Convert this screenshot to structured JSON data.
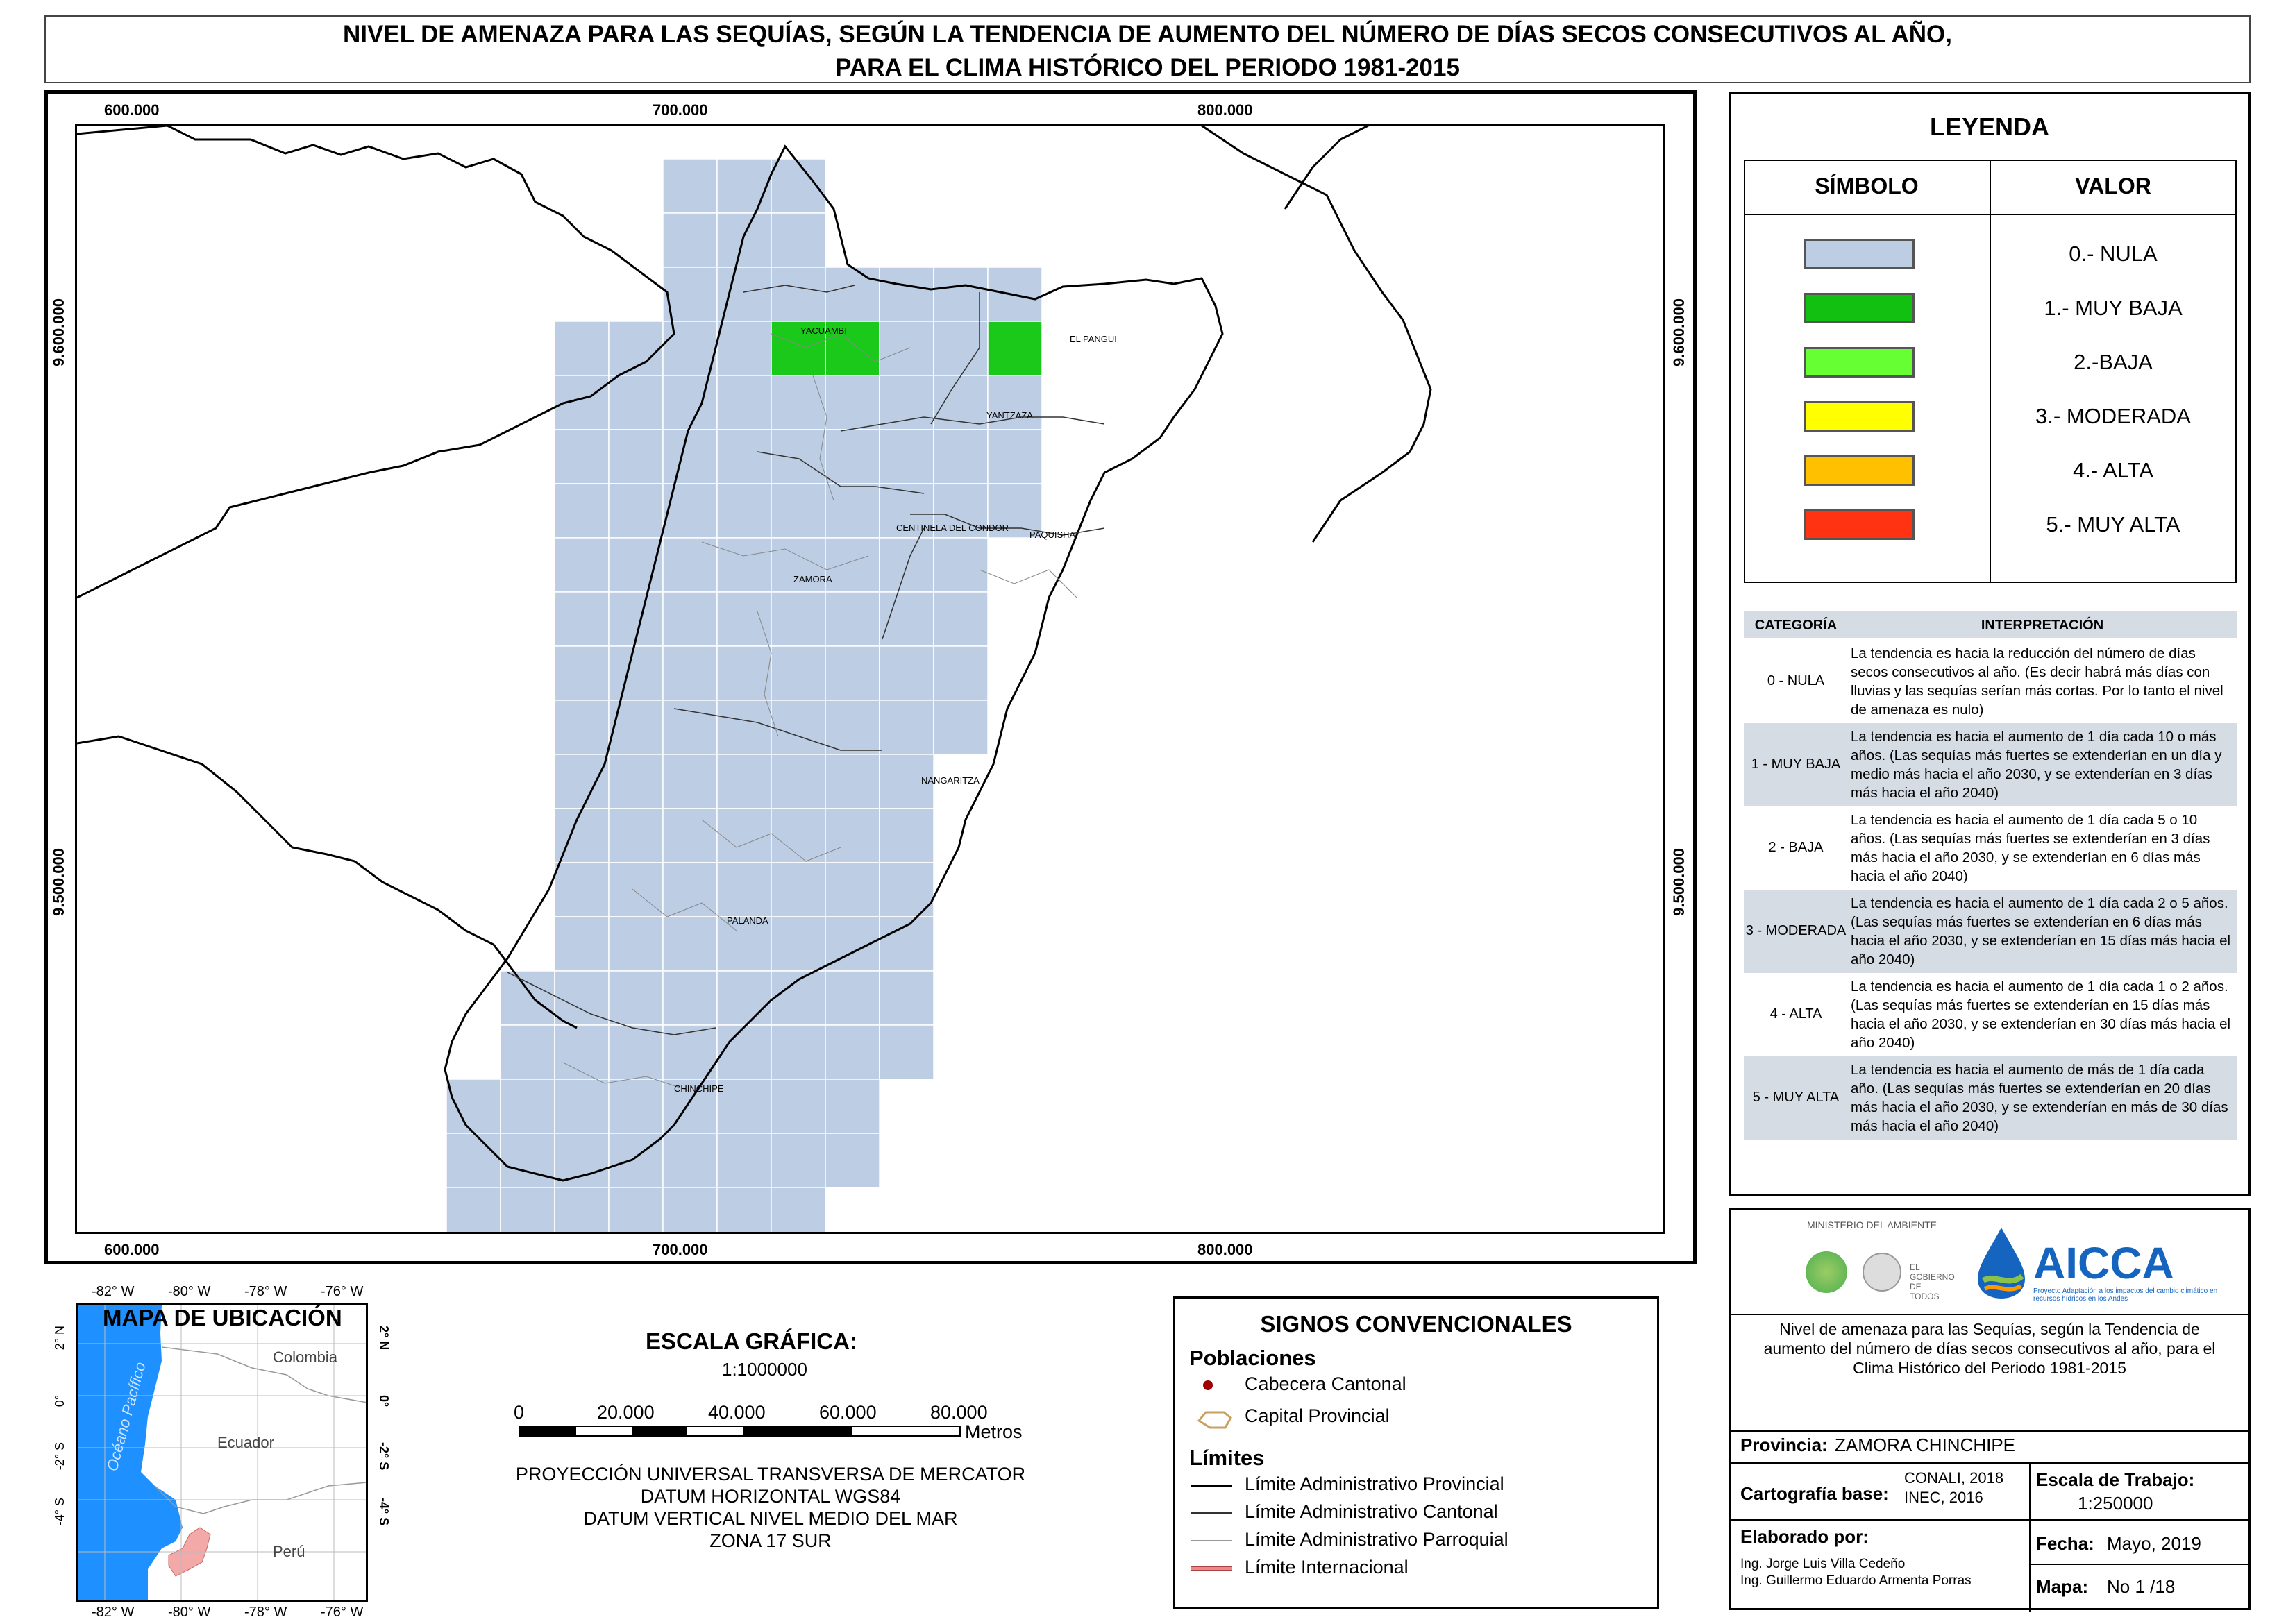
{
  "title": {
    "line1": "NIVEL DE AMENAZA PARA LAS SEQUÍAS, SEGÚN LA TENDENCIA DE AUMENTO DEL NÚMERO DE DÍAS SECOS CONSECUTIVOS AL AÑO,",
    "line2": "PARA EL CLIMA HISTÓRICO DEL PERIODO 1981-2015"
  },
  "map": {
    "x_ticks": [
      "600.000",
      "700.000",
      "800.000"
    ],
    "y_ticks": [
      "9.600.000",
      "9.500.000"
    ],
    "cantons": [
      "YACUAMBI",
      "EL PANGUI",
      "YANTZAZA",
      "CENTINELA DEL CONDOR",
      "PAQUISHA",
      "ZAMORA",
      "NANGARITZA",
      "PALANDA",
      "CHINCHIPE"
    ],
    "colors": {
      "nula": "#bdcde3",
      "muy_baja": "#1bc91b",
      "grid_line": "#ffffff"
    }
  },
  "legend": {
    "title": "LEYENDA",
    "col_symbol": "SÍMBOLO",
    "col_value": "VALOR",
    "items": [
      {
        "label": "0.- NULA",
        "color": "#bdcde3"
      },
      {
        "label": "1.- MUY BAJA",
        "color": "#12c012"
      },
      {
        "label": "2.-BAJA",
        "color": "#66ff33"
      },
      {
        "label": "3.- MODERADA",
        "color": "#ffff00"
      },
      {
        "label": "4.- ALTA",
        "color": "#ffc000"
      },
      {
        "label": "5.- MUY ALTA",
        "color": "#ff3311"
      }
    ],
    "table_headers": {
      "category": "CATEGORÍA",
      "interpretation": "INTERPRETACIÓN"
    },
    "rows": [
      {
        "category": "0 - NULA",
        "text": "La tendencia es hacia la reducción del número de días secos consecutivos al año. (Es decir habrá más días con lluvias y las sequías serían más cortas. Por lo tanto el nivel de amenaza es nulo)"
      },
      {
        "category": "1 - MUY BAJA",
        "text": "La tendencia es hacia el aumento de 1 día cada 10 o más años. (Las sequías más fuertes se extenderían en un día y medio más hacia el año 2030, y se extenderían en 3 días más hacia el año 2040)"
      },
      {
        "category": "2 - BAJA",
        "text": "La tendencia es hacia el aumento de 1 día cada 5 o 10 años. (Las sequías más fuertes se extenderían en 3 días más hacia el año 2030, y se extenderían en 6 días más hacia el año 2040)"
      },
      {
        "category": "3 - MODERADA",
        "text": "La tendencia es hacia el aumento de 1 día cada 2 o 5 años. (Las sequías más fuertes se extenderían en 6 días más hacia el año 2030, y se extenderían en 15 días más hacia el año 2040)"
      },
      {
        "category": "4 - ALTA",
        "text": "La tendencia es hacia el aumento de 1 día cada 1 o 2 años. (Las sequías más fuertes se extenderían en 15 días más hacia el año 2030, y se extenderían en 30 días más hacia el año 2040)"
      },
      {
        "category": "5 - MUY ALTA",
        "text": "La tendencia es hacia el aumento de más de 1 día cada año. (Las sequías más fuertes se extenderían en 20 días más hacia el año 2030, y se extenderían en más de 30 días más hacia el año 2040)"
      }
    ]
  },
  "location_map": {
    "title": "MAPA DE UBICACIÓN",
    "top_ticks": [
      "-82° W",
      "-80° W",
      "-78° W",
      "-76° W"
    ],
    "bottom_ticks": [
      "-82° W",
      "-80° W",
      "-78° W",
      "-76° W"
    ],
    "side_ticks": [
      "2° N",
      "0°",
      "-2° S",
      "-4° S"
    ],
    "countries": [
      "Colombia",
      "Ecuador",
      "Perú"
    ],
    "ocean": "Océano Pacífico"
  },
  "scale": {
    "title": "ESCALA GRÁFICA:",
    "ratio": "1:1000000",
    "labels": [
      "0",
      "20.000",
      "40.000",
      "60.000",
      "80.000"
    ],
    "unit": "Metros",
    "projection": [
      "PROYECCIÓN UNIVERSAL TRANSVERSA DE MERCATOR",
      "DATUM HORIZONTAL WGS84",
      "DATUM VERTICAL NIVEL MEDIO DEL MAR",
      "ZONA 17 SUR"
    ]
  },
  "signs": {
    "title": "SIGNOS CONVENCIONALES",
    "poblaciones": "Poblaciones",
    "cabecera": "Cabecera Cantonal",
    "capital": "Capital Provincial",
    "limites": "Límites",
    "provincial": "Límite Administrativo Provincial",
    "cantonal": "Límite Administrativo Cantonal",
    "parroquial": "Límite Administrativo Parroquial",
    "internacional": "Límite Internacional"
  },
  "info": {
    "ministry": "MINISTERIO DEL AMBIENTE",
    "gob": "EL GOBIERNO DE TODOS",
    "aicca": "AICCA",
    "aicca_sub": "Proyecto Adaptación a los impactos del cambio climático en recursos hídricos en los Andes",
    "description": "Nivel de amenaza para las Sequías, según la Tendencia de aumento del número de días secos consecutivos al año, para el Clima Histórico del Periodo 1981-2015",
    "provincia_label": "Provincia:",
    "provincia": "ZAMORA CHINCHIPE",
    "cartografia_label": "Cartografía base:",
    "cartografia_1": "CONALI, 2018",
    "cartografia_2": "INEC, 2016",
    "escala_label": "Escala de Trabajo:",
    "escala": "1:250000",
    "elaborado_label": "Elaborado por:",
    "autor1": "Ing. Jorge Luis Villa Cedeño",
    "autor2": "Ing. Guillermo Eduardo Armenta Porras",
    "fecha_label": "Fecha:",
    "fecha": "Mayo, 2019",
    "mapa_label": "Mapa:",
    "mapa": "No 1 /18"
  }
}
